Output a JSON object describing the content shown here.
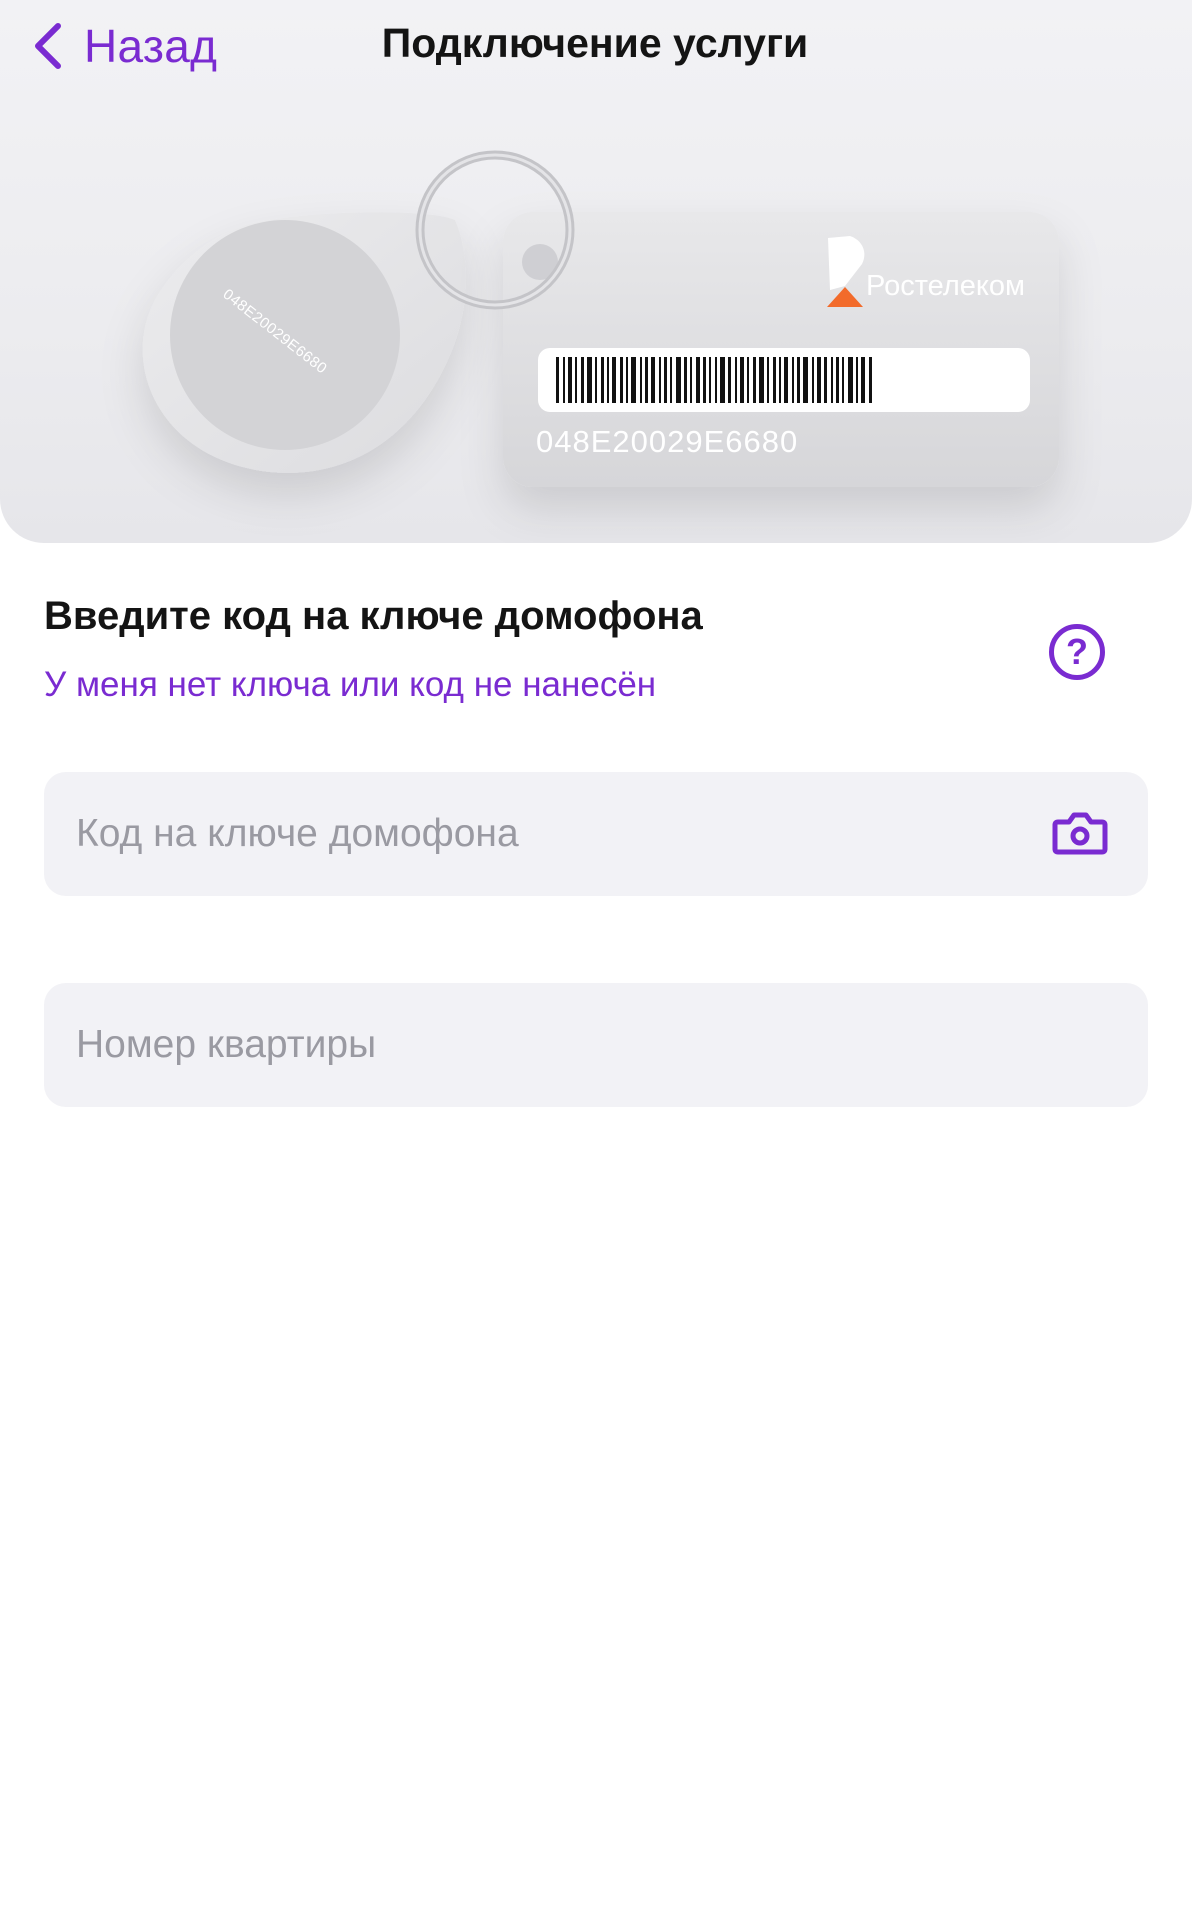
{
  "nav": {
    "back_label": "Назад",
    "title": "Подключение услуги"
  },
  "hero": {
    "brand": "Ростелеком",
    "key_code": "048E20029E6680",
    "brand_accent": "#f26b2b"
  },
  "form": {
    "title": "Введите код на ключе домофона",
    "no_key_link": "У меня нет ключа или код не нанесён",
    "help_symbol": "?",
    "key_code_placeholder": "Код на ключе домофона",
    "apartment_placeholder": "Номер квартиры"
  },
  "icons": {
    "back": "chevron-left-icon",
    "help": "question-circle-icon",
    "camera": "camera-icon"
  },
  "colors": {
    "accent": "#7a2bd1",
    "field_bg": "#f2f2f6",
    "placeholder": "#9a9aa2"
  }
}
